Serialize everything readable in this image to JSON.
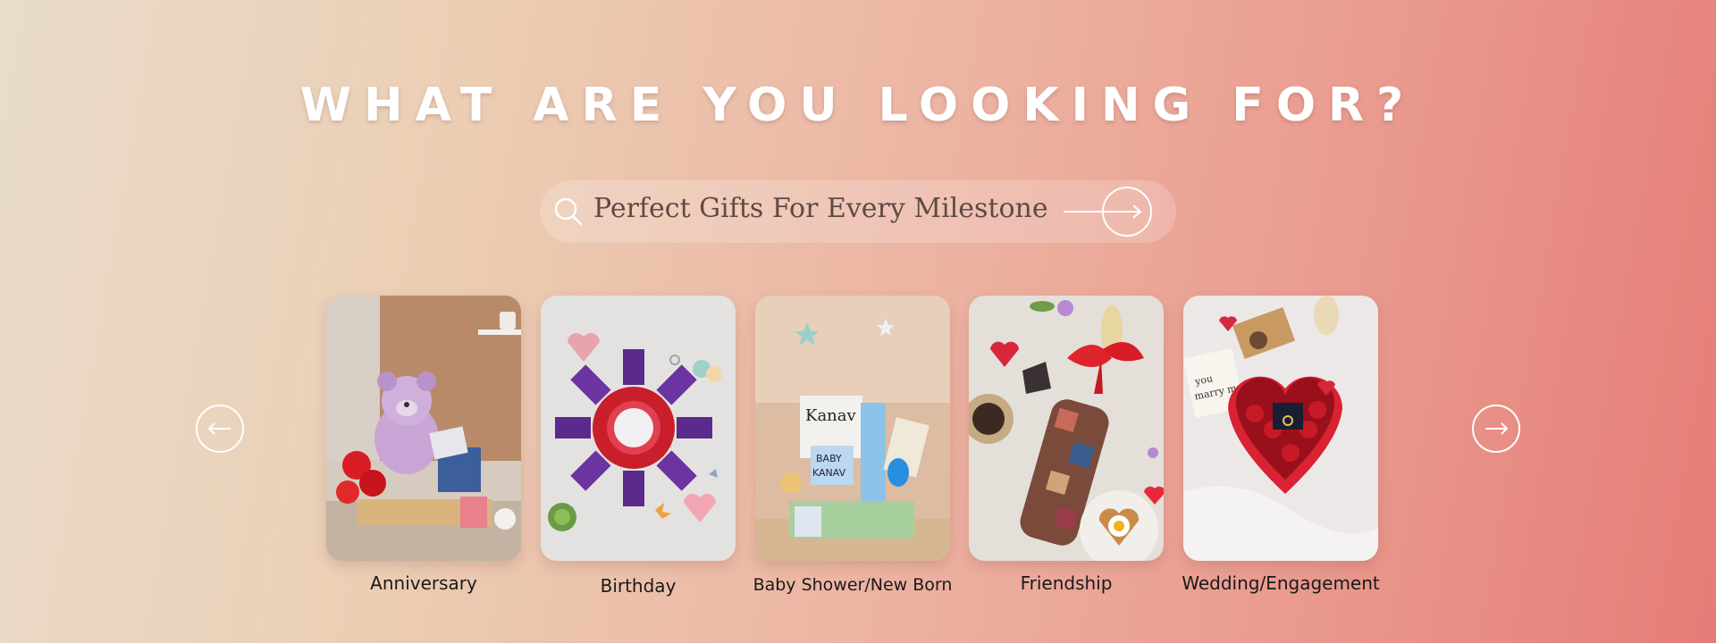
{
  "header": {
    "title": "WHAT ARE YOU LOOKING FOR?"
  },
  "search": {
    "text": "Perfect Gifts For Every Milestone"
  },
  "carousel": {
    "prev_icon": "arrow-left-icon",
    "next_icon": "arrow-right-icon",
    "cards": [
      {
        "label": "Anniversary",
        "image": "teddy-bear-gift-hamper"
      },
      {
        "label": "Birthday",
        "image": "chocolate-bouquet-flatlay"
      },
      {
        "label": "Baby Shower/New Born",
        "image": "baby-gift-basket"
      },
      {
        "label": "Friendship",
        "image": "photo-collage-bottle"
      },
      {
        "label": "Wedding/Engagement",
        "image": "heart-box-roses-ring"
      }
    ]
  },
  "colors": {
    "headline": "#ffffff",
    "search_text": "#5e4a44",
    "label": "#1a1a1a"
  }
}
